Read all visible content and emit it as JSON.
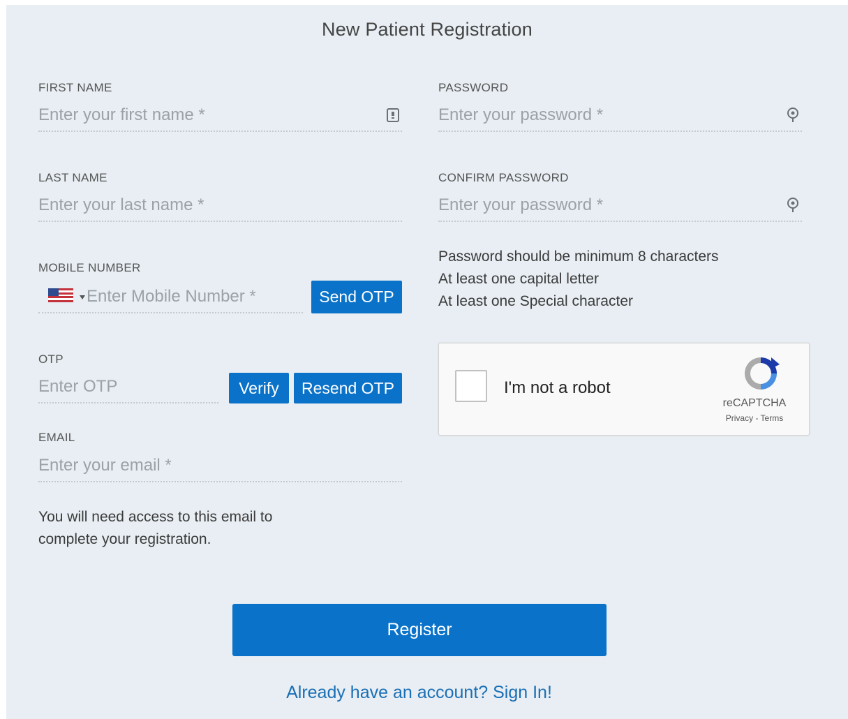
{
  "form": {
    "title": "New Patient Registration",
    "first_name": {
      "label": "FIRST NAME",
      "placeholder": "Enter your first name *",
      "value": ""
    },
    "last_name": {
      "label": "LAST NAME",
      "placeholder": "Enter your last name *",
      "value": ""
    },
    "mobile": {
      "label": "MOBILE NUMBER",
      "placeholder": "Enter Mobile Number *",
      "value": "",
      "country": "us-flag-icon",
      "send_otp_label": "Send OTP"
    },
    "otp": {
      "label": "OTP",
      "placeholder": "Enter OTP",
      "value": "",
      "verify_label": "Verify",
      "resend_label": "Resend OTP"
    },
    "email": {
      "label": "EMAIL",
      "placeholder": "Enter your email *",
      "value": "",
      "note_line1": "You will need access to this email to",
      "note_line2": "complete your registration."
    },
    "password": {
      "label": "PASSWORD",
      "placeholder": "Enter your password *",
      "value": ""
    },
    "confirm_password": {
      "label": "CONFIRM PASSWORD",
      "placeholder": "Enter your password *",
      "value": ""
    },
    "password_rules": [
      "Password should be minimum 8 characters",
      "At least one capital letter",
      "At least one Special character"
    ],
    "captcha": {
      "checkbox_label": "I'm not a robot",
      "brand": "reCAPTCHA",
      "links": "Privacy - Terms",
      "checked": false
    },
    "register_label": "Register",
    "signin_link": "Already have an account? Sign In!"
  },
  "colors": {
    "accent": "#0a72c9",
    "background": "#e8eef3",
    "link": "#1a6fb5"
  },
  "icons": {
    "first_name": "contact-card-icon",
    "password": "key-icon",
    "confirm_password": "key-icon",
    "dropdown": "caret-down-icon"
  }
}
